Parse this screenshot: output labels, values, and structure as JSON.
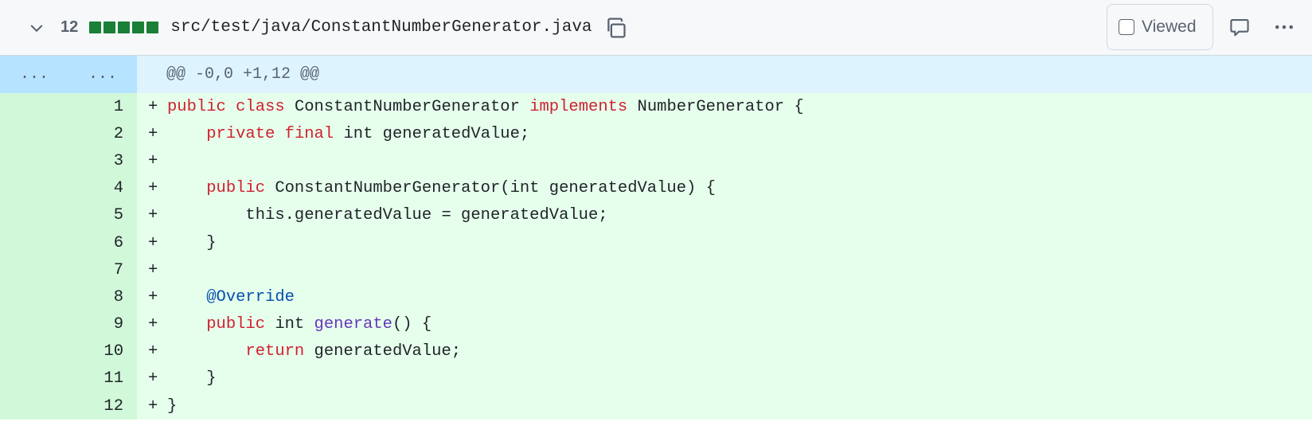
{
  "header": {
    "changed_lines": "12",
    "diffstat_blocks": 5,
    "file_path": "src/test/java/ConstantNumberGenerator.java",
    "viewed_label": "Viewed",
    "viewed_checked": false
  },
  "hunk": {
    "expand_left": "...",
    "expand_right": "...",
    "header": "@@ -0,0 +1,12 @@"
  },
  "lines": [
    {
      "num": "1",
      "marker": "+",
      "tokens": [
        {
          "t": "public",
          "c": "kw"
        },
        {
          "t": " "
        },
        {
          "t": "class",
          "c": "kw"
        },
        {
          "t": " ConstantNumberGenerator "
        },
        {
          "t": "implements",
          "c": "kw"
        },
        {
          "t": " NumberGenerator {"
        }
      ]
    },
    {
      "num": "2",
      "marker": "+",
      "tokens": [
        {
          "t": "    "
        },
        {
          "t": "private",
          "c": "kw"
        },
        {
          "t": " "
        },
        {
          "t": "final",
          "c": "kw"
        },
        {
          "t": " int generatedValue;"
        }
      ]
    },
    {
      "num": "3",
      "marker": "+",
      "tokens": []
    },
    {
      "num": "4",
      "marker": "+",
      "tokens": [
        {
          "t": "    "
        },
        {
          "t": "public",
          "c": "kw"
        },
        {
          "t": " ConstantNumberGenerator(int generatedValue) {"
        }
      ]
    },
    {
      "num": "5",
      "marker": "+",
      "tokens": [
        {
          "t": "        this.generatedValue = generatedValue;"
        }
      ]
    },
    {
      "num": "6",
      "marker": "+",
      "tokens": [
        {
          "t": "    }"
        }
      ]
    },
    {
      "num": "7",
      "marker": "+",
      "tokens": []
    },
    {
      "num": "8",
      "marker": "+",
      "tokens": [
        {
          "t": "    "
        },
        {
          "t": "@Override",
          "c": "ann"
        }
      ]
    },
    {
      "num": "9",
      "marker": "+",
      "tokens": [
        {
          "t": "    "
        },
        {
          "t": "public",
          "c": "kw"
        },
        {
          "t": " int "
        },
        {
          "t": "generate",
          "c": "fn"
        },
        {
          "t": "() {"
        }
      ]
    },
    {
      "num": "10",
      "marker": "+",
      "tokens": [
        {
          "t": "        "
        },
        {
          "t": "return",
          "c": "kw"
        },
        {
          "t": " generatedValue;"
        }
      ]
    },
    {
      "num": "11",
      "marker": "+",
      "tokens": [
        {
          "t": "    }"
        }
      ]
    },
    {
      "num": "12",
      "marker": "+",
      "tokens": [
        {
          "t": "}"
        }
      ]
    }
  ],
  "colors": {
    "added_bg": "#e6ffec",
    "added_gutter": "#d1f8d9",
    "hunk_bg": "#ddf4ff",
    "hunk_gutter": "#b6e3ff",
    "keyword": "#cf222e",
    "function": "#6639ba",
    "annotation": "#0550ae",
    "diffstat_green": "#1a7f37"
  },
  "icons": {
    "collapse": "chevron-down-icon",
    "copy": "copy-icon",
    "comment": "comment-icon",
    "more": "kebab-horizontal-icon"
  }
}
